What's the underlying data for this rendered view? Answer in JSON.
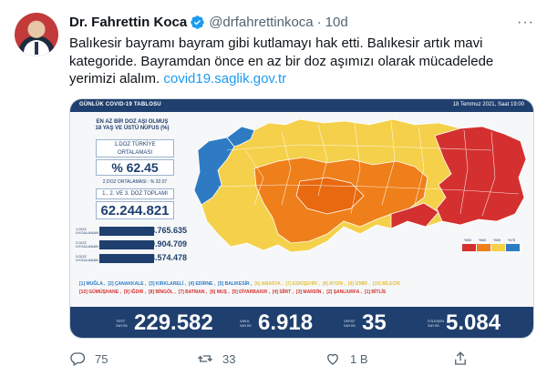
{
  "tweet": {
    "display_name": "Dr. Fahrettin Koca",
    "handle": "@drfahrettinkoca",
    "separator": "·",
    "time": "10d",
    "more_icon": "more-icon",
    "text": "Balıkesir bayramı bayram gibi kutlamayı hak etti. Balıkesir artık mavi kategoride. Bayramdan önce en az bir doz aşımızı olarak mücadelede yerimizi alalım. ",
    "link": "covid19.saglik.gov.tr"
  },
  "image": {
    "header_left": "GÜNLÜK COVID-19 TABLOSU",
    "header_right": "18 Temmuz 2021, Saat 19:00",
    "panel_title_1": "EN AZ BİR DOZ AŞI OLMUŞ",
    "panel_title_2": "18 YAŞ VE ÜSTÜ NÜFUS (%)",
    "avg_label_1": "1.DOZ TÜRKİYE",
    "avg_label_2": "ORTALAMASI",
    "avg_value": "% 62.45",
    "avg2_label": "2.DOZ ORTALAMASI : % 32.07",
    "total_label": "1., 2. VE 3. DOZ TOPLAMI",
    "total_value": "62.244.821",
    "doses": [
      {
        "label": "1.DOZ",
        "sub": "UYGULANAN",
        "value": "38.765.635"
      },
      {
        "label": "2.DOZ",
        "sub": "UYGULANAN",
        "value": "19.904.709"
      },
      {
        "label": "3.DOZ",
        "sub": "UYGULANAN",
        "value": "3.574.478"
      }
    ],
    "provinces_line1": [
      {
        "text": "[1] MUĞLA ,",
        "color": "#2e7bc4"
      },
      {
        "text": "[2] ÇANAKKALE ,",
        "color": "#2e7bc4"
      },
      {
        "text": "[3] KIRKLARELİ ,",
        "color": "#2e7bc4"
      },
      {
        "text": "[4] EDİRNE ,",
        "color": "#2e7bc4"
      },
      {
        "text": "[5] BALIKESİR ,",
        "color": "#2e7bc4"
      },
      {
        "text": "[6] AMASYA ,",
        "color": "#e3c23a"
      },
      {
        "text": "[7] ESKİŞEHİR ,",
        "color": "#e3c23a"
      },
      {
        "text": "[8] AYDIN ,",
        "color": "#e3c23a"
      },
      {
        "text": "[9] İZMİR ,",
        "color": "#e3c23a"
      },
      {
        "text": "[10] BİLECİK",
        "color": "#e3c23a"
      }
    ],
    "provinces_line2": [
      {
        "text": "[10] GÜMÜŞHANE ,",
        "color": "#d4302f"
      },
      {
        "text": "[9] IĞDIR ,",
        "color": "#d4302f"
      },
      {
        "text": "[8] BİNGÖL ,",
        "color": "#d4302f"
      },
      {
        "text": "[7] BATMAN ,",
        "color": "#d4302f"
      },
      {
        "text": "[6] MUŞ ,",
        "color": "#d4302f"
      },
      {
        "text": "[5] DİYARBAKIR ,",
        "color": "#d4302f"
      },
      {
        "text": "[4] SİİRT ,",
        "color": "#d4302f"
      },
      {
        "text": "[3] MARDİN ,",
        "color": "#d4302f"
      },
      {
        "text": "[2] ŞANLIURFA ,",
        "color": "#d4302f"
      },
      {
        "text": "[1] BİTLİS",
        "color": "#d4302f"
      }
    ],
    "legend": [
      "%50",
      "%60",
      "%65",
      "%75"
    ],
    "legend_colors": [
      "#d4302f",
      "#ef7f1a",
      "#f5d04a",
      "#2e7bc4"
    ],
    "bottom_stats": [
      {
        "label_1": "TEST",
        "label_2": "SAYISI",
        "value": "229.582"
      },
      {
        "label_1": "VAKA",
        "label_2": "SAYISI",
        "value": "6.918"
      },
      {
        "label_1": "VEFAT",
        "label_2": "SAYISI",
        "value": "35"
      },
      {
        "label_1": "İYİLEŞEN",
        "label_2": "SAYISI",
        "value": "5.084"
      }
    ]
  },
  "actions": {
    "reply_count": "75",
    "retweet_count": "33",
    "like_count": "1 B",
    "reply_icon": "reply-icon",
    "retweet_icon": "retweet-icon",
    "like_icon": "like-icon",
    "share_icon": "share-icon"
  },
  "colors": {
    "link": "#1d9bf0",
    "verified": "#1d9bf0",
    "muted": "#536471",
    "navy": "#1f3f6e"
  }
}
